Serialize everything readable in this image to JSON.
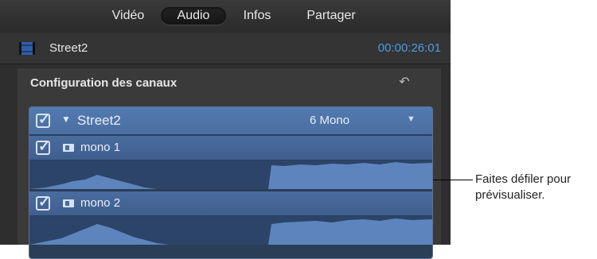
{
  "tabs": [
    "Vidéo",
    "Audio",
    "Infos",
    "Partager"
  ],
  "active_tab": "Audio",
  "clip": {
    "name": "Street2",
    "timecode": "00:00:26:01"
  },
  "section": {
    "title": "Configuration des canaux"
  },
  "channels": {
    "main": {
      "name": "Street2",
      "format": "6 Mono"
    },
    "items": [
      {
        "name": "mono 1"
      },
      {
        "name": "mono 2"
      }
    ]
  },
  "callout": {
    "line1": "Faites défiler pour",
    "line2": "prévisualiser."
  },
  "icons": {
    "film": "film-strip-icon",
    "reset": "reset-arrow-icon",
    "disclosure": "disclosure-triangle-icon",
    "dropdown": "dropdown-arrow-icon",
    "speaker": "speaker-icon",
    "checkbox": "checkbox-checked-icon"
  },
  "colors": {
    "accent": "#4a9be4",
    "channel_row": "#4a6c9e",
    "panel": "#2e2e2e"
  }
}
